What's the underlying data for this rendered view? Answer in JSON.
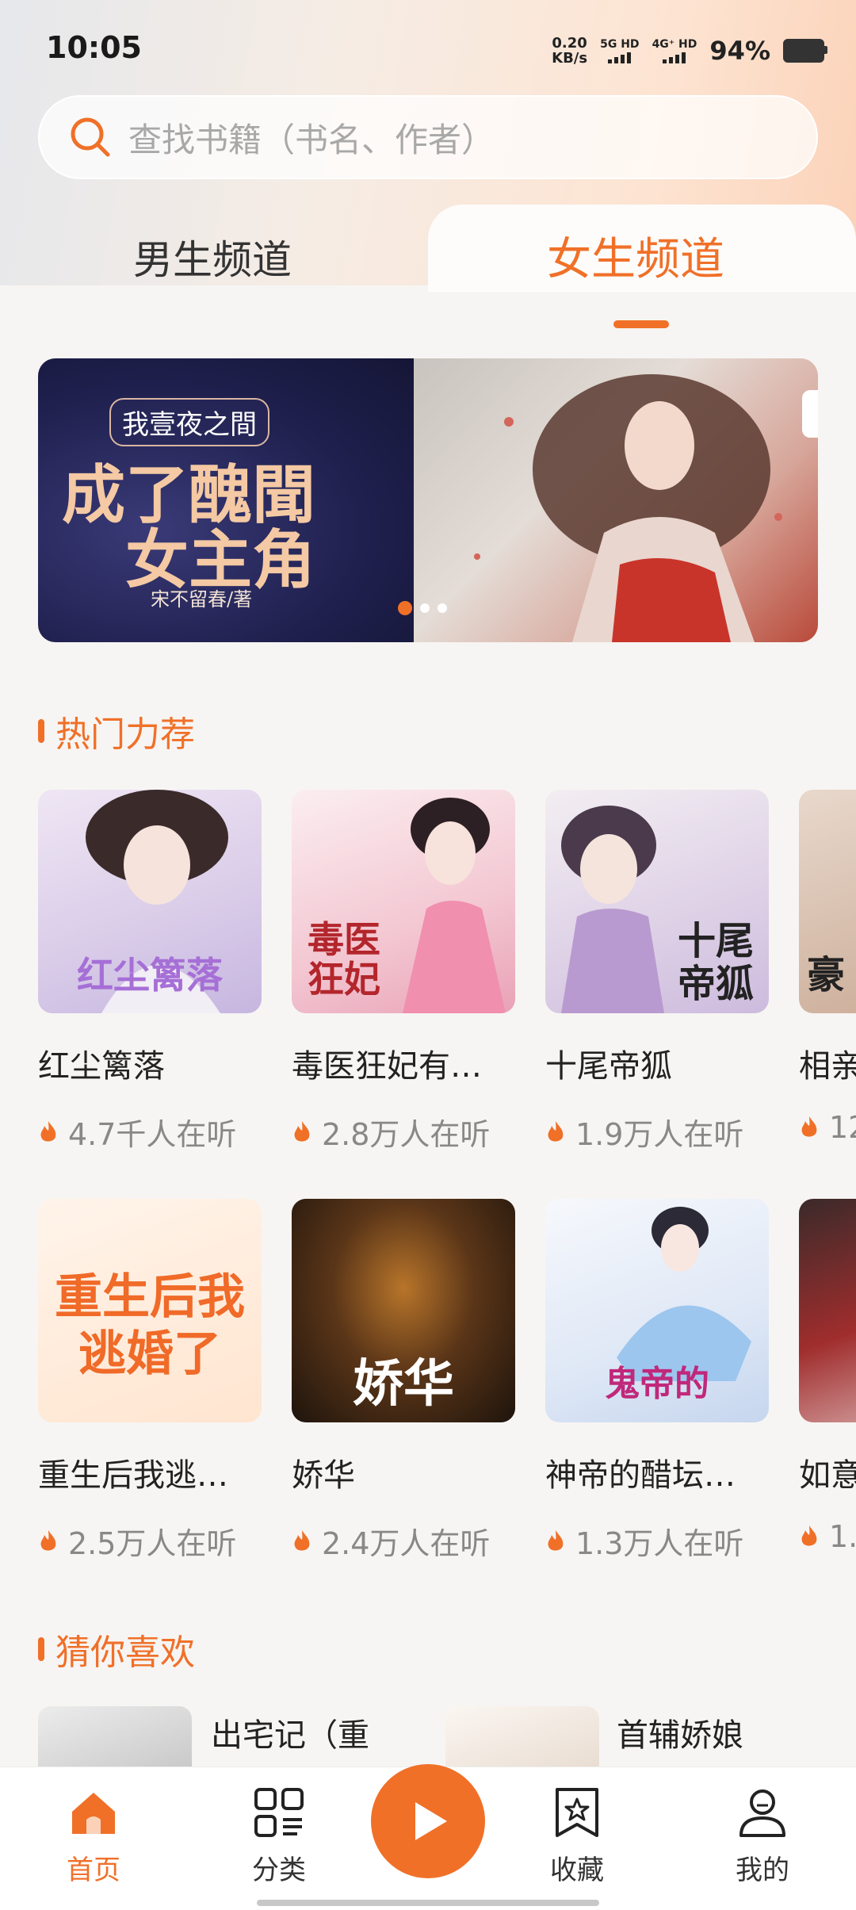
{
  "status_bar": {
    "time": "10:05",
    "net_speed_top": "0.20",
    "net_speed_bottom": "KB/s",
    "sim1": "5G HD",
    "sim2": "4G⁺ HD",
    "battery": "94%"
  },
  "search": {
    "placeholder": "查找书籍（书名、作者）"
  },
  "tabs": [
    {
      "label": "男生频道",
      "active": false
    },
    {
      "label": "女生频道",
      "active": true
    }
  ],
  "banner": {
    "subtitle": "我壹夜之間",
    "title_line1": "成了醜聞",
    "title_line2": "女主角",
    "author": "宋不留春/著",
    "page_count": 3,
    "active_page": 1
  },
  "sections": {
    "hot": "热门力荐",
    "guess": "猜你喜欢"
  },
  "hot_books": [
    {
      "title": "红尘篱落",
      "listeners": "4.7千人在听",
      "cover_text": "红尘篱落"
    },
    {
      "title": "毒医狂妃有…",
      "listeners": "2.8万人在听",
      "cover_text": "毒医狂妃"
    },
    {
      "title": "十尾帝狐",
      "listeners": "1.9万人在听",
      "cover_text": "十尾帝狐"
    },
    {
      "title": "相亲",
      "listeners": "12",
      "cover_text": "豪"
    },
    {
      "title": "重生后我逃…",
      "listeners": "2.5万人在听",
      "cover_text": "重生后我逃婚了"
    },
    {
      "title": "娇华",
      "listeners": "2.4万人在听",
      "cover_text": "娇华"
    },
    {
      "title": "神帝的醋坛…",
      "listeners": "1.3万人在听",
      "cover_text": "鬼帝的"
    },
    {
      "title": "如意",
      "listeners": "1.",
      "cover_text": ""
    }
  ],
  "guess_books": [
    {
      "title": "出宅记（重"
    },
    {
      "title": "首辅娇娘"
    }
  ],
  "nav": [
    {
      "label": "首页",
      "active": true
    },
    {
      "label": "分类",
      "active": false
    },
    {
      "label": "收藏",
      "active": false
    },
    {
      "label": "我的",
      "active": false
    }
  ],
  "colors": {
    "accent": "#f07028"
  }
}
